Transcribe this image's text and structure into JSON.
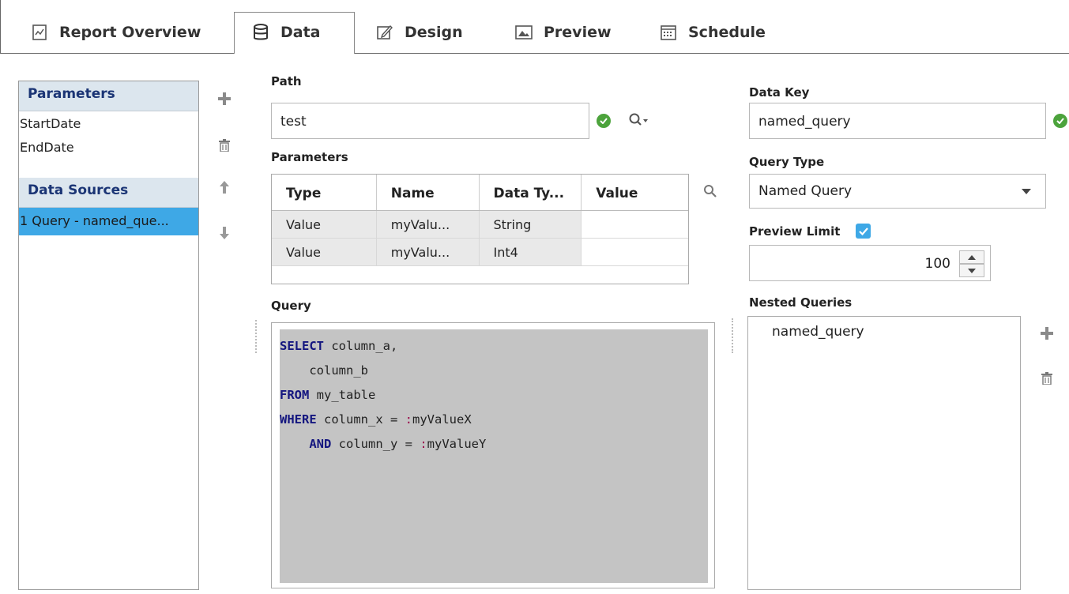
{
  "tabs": [
    {
      "label": "Report Overview",
      "icon": "report-icon"
    },
    {
      "label": "Data",
      "icon": "database-icon",
      "active": true
    },
    {
      "label": "Design",
      "icon": "edit-icon"
    },
    {
      "label": "Preview",
      "icon": "image-icon"
    },
    {
      "label": "Schedule",
      "icon": "calendar-icon"
    }
  ],
  "left_panel": {
    "parameters_header": "Parameters",
    "parameters": [
      "StartDate",
      "EndDate"
    ],
    "data_sources_header": "Data Sources",
    "data_sources": [
      "1 Query - named_que..."
    ]
  },
  "path": {
    "label": "Path",
    "value": "test"
  },
  "parameters_table": {
    "label": "Parameters",
    "columns": [
      "Type",
      "Name",
      "Data Ty...",
      "Value"
    ],
    "rows": [
      [
        "Value",
        "myValu...",
        "String",
        ""
      ],
      [
        "Value",
        "myValu...",
        "Int4",
        ""
      ]
    ]
  },
  "query": {
    "label": "Query",
    "lines": [
      [
        {
          "t": "kw",
          "v": "SELECT"
        },
        {
          "t": "tx",
          "v": " column_a,"
        }
      ],
      [
        {
          "t": "tx",
          "v": "    column_b"
        }
      ],
      [
        {
          "t": "kw",
          "v": "FROM"
        },
        {
          "t": "tx",
          "v": " my_table"
        }
      ],
      [
        {
          "t": "kw",
          "v": "WHERE"
        },
        {
          "t": "tx",
          "v": " column_x = "
        },
        {
          "t": "pm",
          "v": ":"
        },
        {
          "t": "tx",
          "v": "myValueX"
        }
      ],
      [
        {
          "t": "tx",
          "v": "    "
        },
        {
          "t": "kw",
          "v": "AND"
        },
        {
          "t": "tx",
          "v": " column_y = "
        },
        {
          "t": "pm",
          "v": ":"
        },
        {
          "t": "tx",
          "v": "myValueY"
        }
      ]
    ]
  },
  "data_key": {
    "label": "Data Key",
    "value": "named_query"
  },
  "query_type": {
    "label": "Query Type",
    "value": "Named Query"
  },
  "preview_limit": {
    "label": "Preview Limit",
    "checked": true,
    "value": "100"
  },
  "nested_queries": {
    "label": "Nested Queries",
    "items": [
      "named_query"
    ]
  },
  "colors": {
    "accent": "#3ea8e6",
    "header_bg": "#dce6ee",
    "header_text": "#1b3575",
    "ok": "#4ca33c",
    "editor_bg": "#c4c4c4"
  }
}
